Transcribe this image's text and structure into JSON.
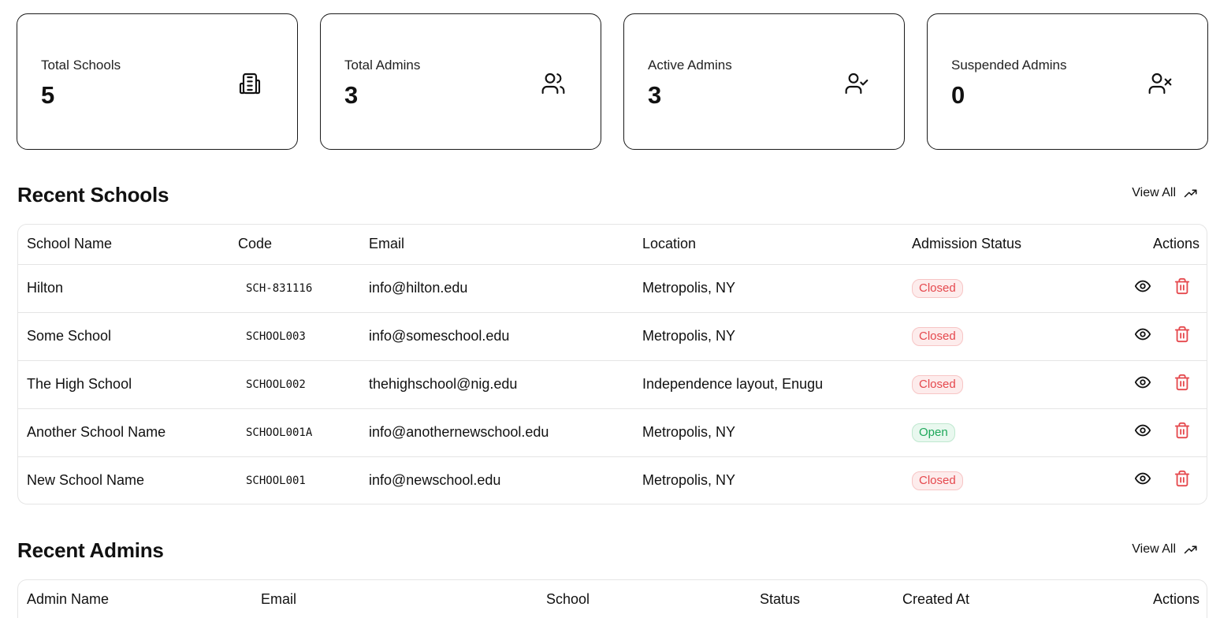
{
  "stats": [
    {
      "label": "Total Schools",
      "value": "5",
      "icon": "building-icon"
    },
    {
      "label": "Total Admins",
      "value": "3",
      "icon": "users-icon"
    },
    {
      "label": "Active Admins",
      "value": "3",
      "icon": "user-check-icon"
    },
    {
      "label": "Suspended Admins",
      "value": "0",
      "icon": "user-x-icon"
    }
  ],
  "recent_schools": {
    "title": "Recent Schools",
    "view_all": "View All",
    "columns": [
      "School Name",
      "Code",
      "Email",
      "Location",
      "Admission Status",
      "Actions"
    ],
    "rows": [
      {
        "name": "Hilton",
        "code": "SCH-831116",
        "email": "info@hilton.edu",
        "location": "Metropolis, NY",
        "status": "Closed"
      },
      {
        "name": "Some School",
        "code": "SCHOOL003",
        "email": "info@someschool.edu",
        "location": "Metropolis, NY",
        "status": "Closed"
      },
      {
        "name": "The High School",
        "code": "SCHOOL002",
        "email": "thehighschool@nig.edu",
        "location": "Independence layout, Enugu",
        "status": "Closed"
      },
      {
        "name": "Another School Name",
        "code": "SCHOOL001A",
        "email": "info@anothernewschool.edu",
        "location": "Metropolis, NY",
        "status": "Open"
      },
      {
        "name": "New School Name",
        "code": "SCHOOL001",
        "email": "info@newschool.edu",
        "location": "Metropolis, NY",
        "status": "Closed"
      }
    ]
  },
  "recent_admins": {
    "title": "Recent Admins",
    "view_all": "View All",
    "columns": [
      "Admin Name",
      "Email",
      "School",
      "Status",
      "Created At",
      "Actions"
    ]
  },
  "colors": {
    "closed": "#e5484d",
    "open": "#1ea85a",
    "delete": "#e5484d"
  }
}
